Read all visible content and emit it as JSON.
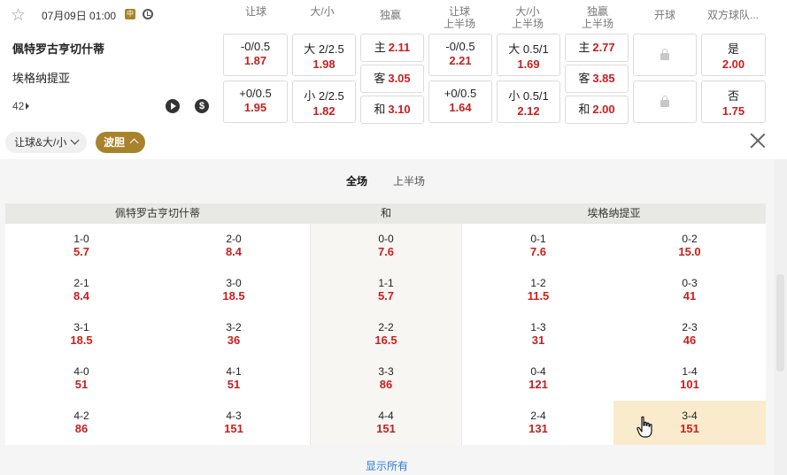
{
  "match": {
    "datetime": "07月09日 01:00",
    "live_badge": "中",
    "home_team": "佩特罗古亨切什蒂",
    "away_team": "埃格纳提亚",
    "more_markets_count": "42",
    "play_icon": "play-icon",
    "dollar_icon": "dollar-icon"
  },
  "columns": [
    {
      "l1": "让球",
      "l2": ""
    },
    {
      "l1": "大/小",
      "l2": ""
    },
    {
      "l1": "独赢",
      "l2": ""
    },
    {
      "l1": "让球",
      "l2": "上半场"
    },
    {
      "l1": "大/小",
      "l2": "上半场"
    },
    {
      "l1": "独赢",
      "l2": "上半场"
    },
    {
      "l1": "开球",
      "l2": ""
    },
    {
      "l1": "双方球队...",
      "l2": ""
    }
  ],
  "odds": {
    "hdp": [
      {
        "line": "-0/0.5",
        "odd": "1.87"
      },
      {
        "line": "+0/0.5",
        "odd": "1.95"
      }
    ],
    "ou": [
      {
        "line": "大 2/2.5",
        "odd": "1.98"
      },
      {
        "line": "小 2/2.5",
        "odd": "1.82"
      }
    ],
    "x12": [
      {
        "label": "主",
        "odd": "2.11"
      },
      {
        "label": "客",
        "odd": "3.05"
      },
      {
        "label": "和",
        "odd": "3.10"
      }
    ],
    "hdp_1h": [
      {
        "line": "-0/0.5",
        "odd": "2.21"
      },
      {
        "line": "+0/0.5",
        "odd": "1.64"
      }
    ],
    "ou_1h": [
      {
        "line": "大 0.5/1",
        "odd": "1.69"
      },
      {
        "line": "小 0.5/1",
        "odd": "2.12"
      }
    ],
    "x12_1h": [
      {
        "label": "主",
        "odd": "2.77"
      },
      {
        "label": "客",
        "odd": "3.85"
      },
      {
        "label": "和",
        "odd": "2.00"
      }
    ],
    "btts": [
      {
        "label": "是",
        "odd": "2.00"
      },
      {
        "label": "否",
        "odd": "1.75"
      }
    ]
  },
  "toggles": {
    "market_pill": "让球&大/小",
    "correct_score_pill": "波胆"
  },
  "correct_score": {
    "tabs": [
      "全场",
      "上半场"
    ],
    "active_tab": "全场",
    "headers": {
      "home": "佩特罗古亨切什蒂",
      "draw": "和",
      "away": "埃格纳提亚"
    },
    "rows": [
      [
        {
          "s": "1-0",
          "p": "5.7"
        },
        {
          "s": "2-0",
          "p": "8.4"
        },
        {
          "s": "0-0",
          "p": "7.6"
        },
        {
          "s": "0-1",
          "p": "7.6"
        },
        {
          "s": "0-2",
          "p": "15.0"
        }
      ],
      [
        {
          "s": "2-1",
          "p": "8.4"
        },
        {
          "s": "3-0",
          "p": "18.5"
        },
        {
          "s": "1-1",
          "p": "5.7"
        },
        {
          "s": "1-2",
          "p": "11.5"
        },
        {
          "s": "0-3",
          "p": "41"
        }
      ],
      [
        {
          "s": "3-1",
          "p": "18.5"
        },
        {
          "s": "3-2",
          "p": "36"
        },
        {
          "s": "2-2",
          "p": "16.5"
        },
        {
          "s": "1-3",
          "p": "31"
        },
        {
          "s": "2-3",
          "p": "46"
        }
      ],
      [
        {
          "s": "4-0",
          "p": "51"
        },
        {
          "s": "4-1",
          "p": "51"
        },
        {
          "s": "3-3",
          "p": "86"
        },
        {
          "s": "0-4",
          "p": "121"
        },
        {
          "s": "1-4",
          "p": "101"
        }
      ],
      [
        {
          "s": "4-2",
          "p": "86"
        },
        {
          "s": "4-3",
          "p": "151"
        },
        {
          "s": "4-4",
          "p": "151"
        },
        {
          "s": "2-4",
          "p": "131"
        },
        {
          "s": "3-4",
          "p": "151"
        }
      ]
    ],
    "show_all": "显示所有"
  },
  "colors": {
    "accent": "#a9832a",
    "odds": "#c8201e",
    "link": "#2a7ad6",
    "hover": "#faebcc"
  }
}
